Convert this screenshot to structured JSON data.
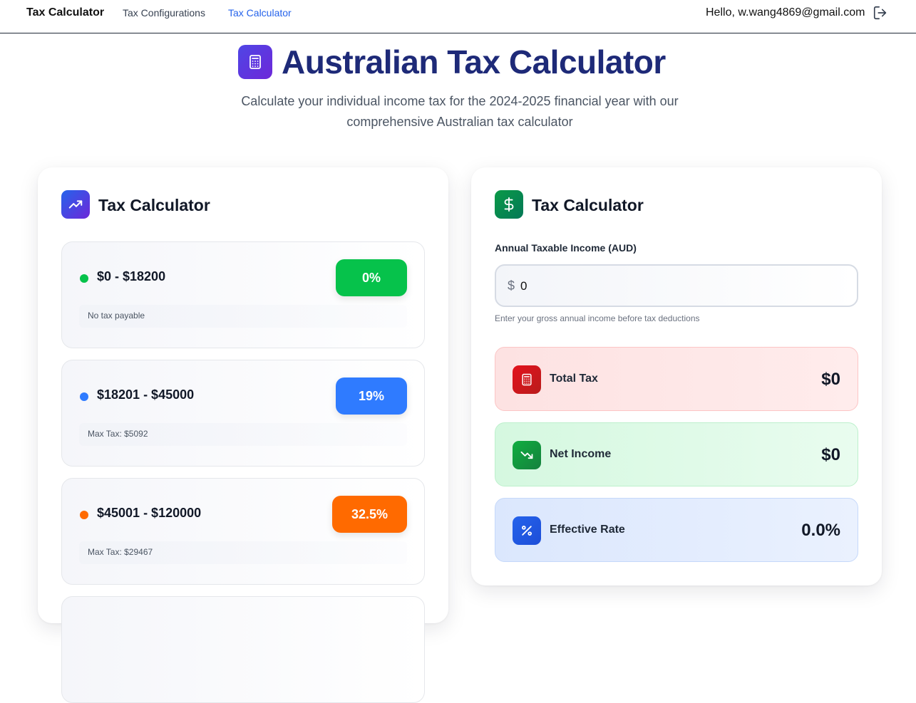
{
  "nav": {
    "brand": "Tax Calculator",
    "links": [
      "Tax Configurations",
      "Tax Calculator"
    ],
    "active_link": "Tax Calculator",
    "greeting": "Hello, w.wang4869@gmail.com"
  },
  "hero": {
    "title": "Australian Tax Calculator",
    "subtitle": "Calculate your individual income tax for the 2024-2025 financial year with our comprehensive Australian tax calculator"
  },
  "brackets_card": {
    "title": "Tax Calculator",
    "brackets": [
      {
        "range": "$0 - $18200",
        "rate": "0%",
        "note": "No tax payable",
        "color": "#06c24b"
      },
      {
        "range": "$18201 - $45000",
        "rate": "19%",
        "note": "Max Tax: $5092",
        "color": "#2f7bff"
      },
      {
        "range": "$45001 - $120000",
        "rate": "32.5%",
        "note": "Max Tax: $29467",
        "color": "#ff6a00"
      }
    ]
  },
  "calculator_card": {
    "title": "Tax Calculator",
    "income_label": "Annual Taxable Income (AUD)",
    "currency_symbol": "$",
    "income_value": "0",
    "income_hint": "Enter your gross annual income before tax deductions",
    "results": [
      {
        "label": "Total Tax",
        "value": "$0"
      },
      {
        "label": "Net Income",
        "value": "$0"
      },
      {
        "label": "Effective Rate",
        "value": "0.0%"
      }
    ]
  },
  "colors": {
    "title_navy": "#1e2a78",
    "accent_blue": "#2563eb",
    "icon_purple": "#4f46e5",
    "icon_green": "#0a9a47",
    "tax_red": "#e3121c",
    "net_green": "#0fae40",
    "rate_blue": "#2563eb"
  }
}
